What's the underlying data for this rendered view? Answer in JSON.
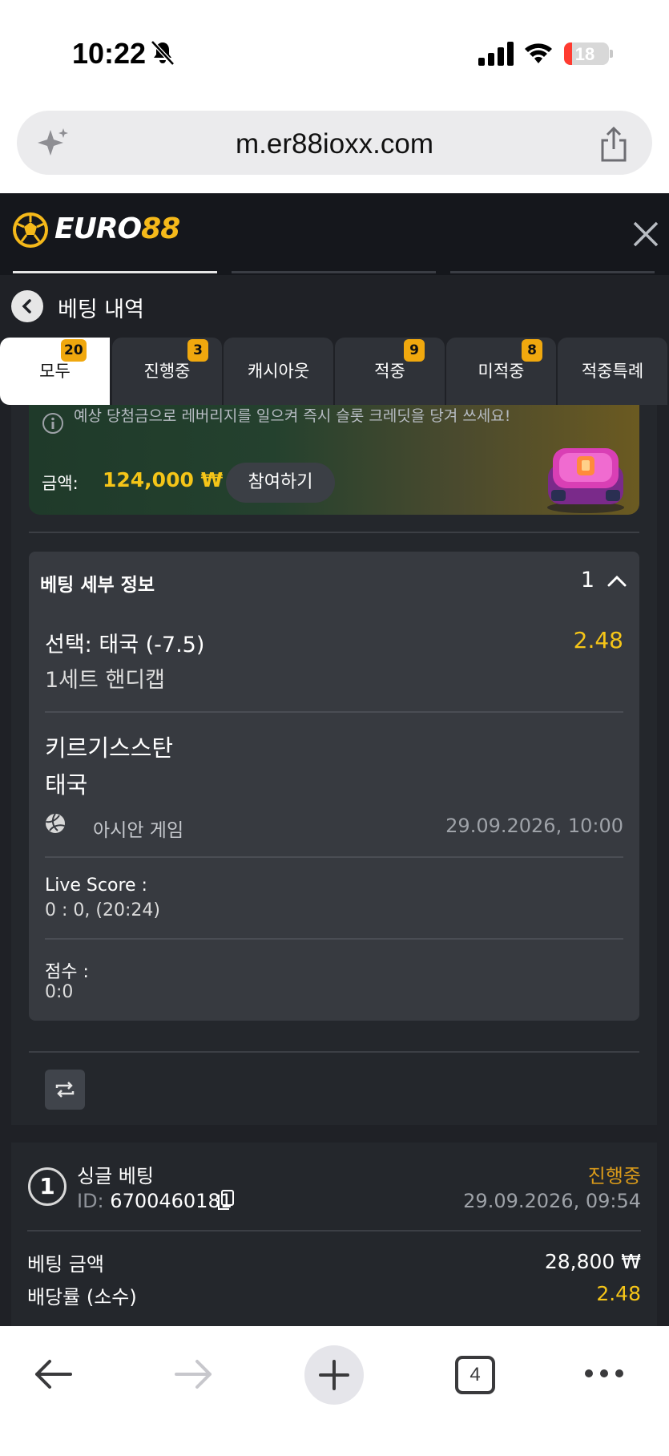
{
  "status_bar": {
    "time": "10:22",
    "battery": "18"
  },
  "browser": {
    "url": "m.er88ioxx.com",
    "tab_count": "4"
  },
  "app": {
    "logo_white": "EURO",
    "logo_yellow": "88"
  },
  "page": {
    "title": "베팅 내역"
  },
  "tabs": [
    {
      "label": "모두",
      "badge": "20"
    },
    {
      "label": "진행중",
      "badge": "3"
    },
    {
      "label": "캐시아웃",
      "badge": ""
    },
    {
      "label": "적중",
      "badge": "9"
    },
    {
      "label": "미적중",
      "badge": "8"
    },
    {
      "label": "적중특례",
      "badge": ""
    }
  ],
  "promo": {
    "description": "예상 당첨금으로 레버리지를 일으켜 즉시 슬롯 크레딧을 당겨 쓰세요!",
    "amount_label": "금액:",
    "amount_value": "124,000 ₩",
    "join_label": "참여하기"
  },
  "bet_details": {
    "header": "베팅 세부 정보",
    "count": "1",
    "selection": "선택: 태국 (-7.5)",
    "odds": "2.48",
    "market": "1세트 핸디캡",
    "team_home": "키르기스스탄",
    "team_away": "태국",
    "league": "아시안 게임",
    "event_datetime": "29.09.2026, 10:00",
    "live_score_label": "Live Score :",
    "live_score_value": "0 : 0, (20:24)",
    "score_label": "점수 :",
    "score_value": "0:0"
  },
  "bet_card": {
    "index": "1",
    "type": "싱글 베팅",
    "id_label": "ID:",
    "id_value": "6700460181",
    "status": "진행중",
    "placed_at": "29.09.2026, 09:54",
    "stake_label": "베팅 금액",
    "stake_value": "28,800 ₩",
    "odds_label": "배당률 (소수)",
    "odds_value": "2.48"
  },
  "colors": {
    "accent": "#f5c518",
    "status_pending": "#d99a1a",
    "badge": "#f0a80e"
  }
}
